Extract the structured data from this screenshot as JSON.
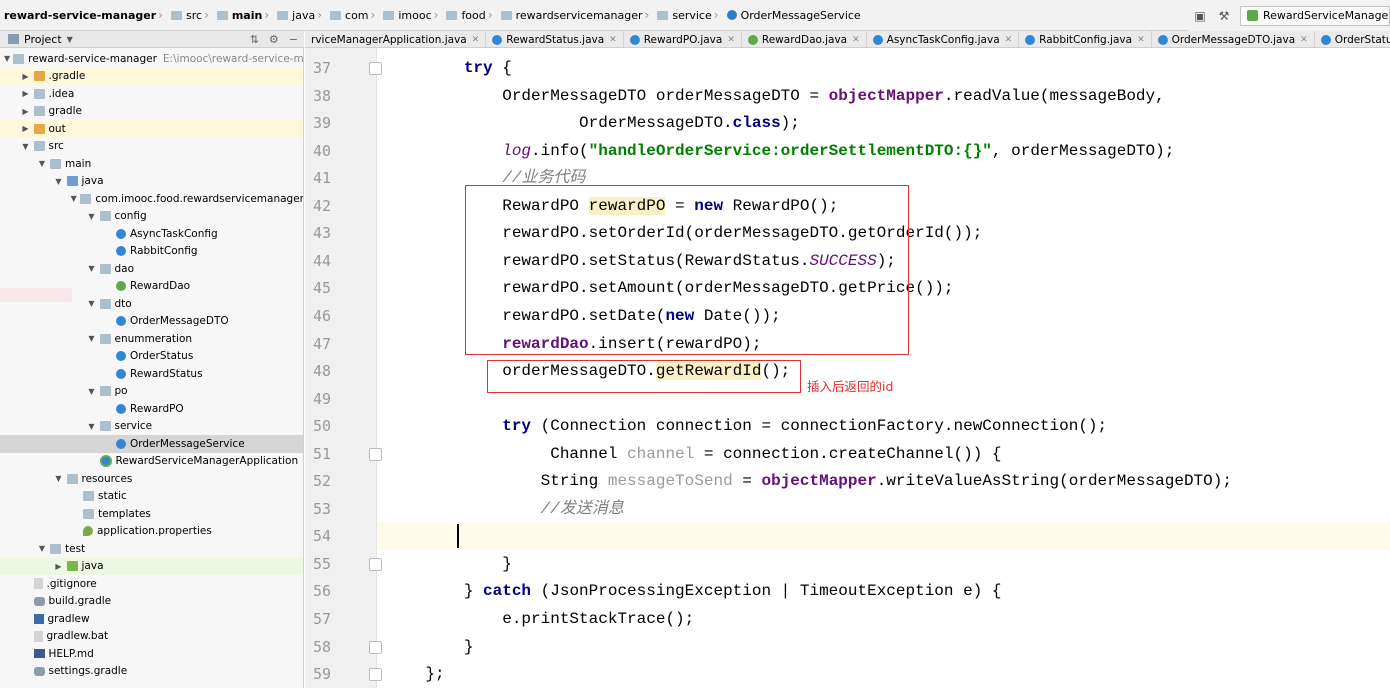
{
  "breadcrumb": [
    "reward-service-manager",
    "src",
    "main",
    "java",
    "com",
    "imooc",
    "food",
    "rewardservicemanager",
    "service",
    "OrderMessageService"
  ],
  "run_config": "RewardServiceManagerApplication",
  "project_panel": {
    "title": "Project",
    "root_label": "reward-service-manager",
    "root_path": "E:\\imooc\\reward-service-manager"
  },
  "tree": [
    {
      "label": ".gradle",
      "depth": 1,
      "arrow": "right",
      "icon": "folder-orange",
      "hl": "hl"
    },
    {
      "label": ".idea",
      "depth": 1,
      "arrow": "right",
      "icon": "folder"
    },
    {
      "label": "gradle",
      "depth": 1,
      "arrow": "right",
      "icon": "folder"
    },
    {
      "label": "out",
      "depth": 1,
      "arrow": "right",
      "icon": "folder-orange",
      "hl": "hl"
    },
    {
      "label": "src",
      "depth": 1,
      "arrow": "down",
      "icon": "folder"
    },
    {
      "label": "main",
      "depth": 2,
      "arrow": "down",
      "icon": "folder"
    },
    {
      "label": "java",
      "depth": 3,
      "arrow": "down",
      "icon": "folder-blue"
    },
    {
      "label": "com.imooc.food.rewardservicemanager",
      "depth": 4,
      "arrow": "down",
      "icon": "pkg"
    },
    {
      "label": "config",
      "depth": 5,
      "arrow": "down",
      "icon": "pkg"
    },
    {
      "label": "AsyncTaskConfig",
      "depth": 6,
      "arrow": "",
      "icon": "cls"
    },
    {
      "label": "RabbitConfig",
      "depth": 6,
      "arrow": "",
      "icon": "cls"
    },
    {
      "label": "dao",
      "depth": 5,
      "arrow": "down",
      "icon": "pkg"
    },
    {
      "label": "RewardDao",
      "depth": 6,
      "arrow": "",
      "icon": "intf"
    },
    {
      "label": "dto",
      "depth": 5,
      "arrow": "down",
      "icon": "pkg"
    },
    {
      "label": "OrderMessageDTO",
      "depth": 6,
      "arrow": "",
      "icon": "cls"
    },
    {
      "label": "enummeration",
      "depth": 5,
      "arrow": "down",
      "icon": "pkg"
    },
    {
      "label": "OrderStatus",
      "depth": 6,
      "arrow": "",
      "icon": "enumi"
    },
    {
      "label": "RewardStatus",
      "depth": 6,
      "arrow": "",
      "icon": "enumi"
    },
    {
      "label": "po",
      "depth": 5,
      "arrow": "down",
      "icon": "pkg"
    },
    {
      "label": "RewardPO",
      "depth": 6,
      "arrow": "",
      "icon": "cls"
    },
    {
      "label": "service",
      "depth": 5,
      "arrow": "down",
      "icon": "pkg"
    },
    {
      "label": "OrderMessageService",
      "depth": 6,
      "arrow": "",
      "icon": "cls",
      "hl": "sel"
    },
    {
      "label": "RewardServiceManagerApplication",
      "depth": 5,
      "arrow": "",
      "icon": "app"
    },
    {
      "label": "resources",
      "depth": 3,
      "arrow": "down",
      "icon": "folder"
    },
    {
      "label": "static",
      "depth": 4,
      "arrow": "",
      "icon": "folder"
    },
    {
      "label": "templates",
      "depth": 4,
      "arrow": "",
      "icon": "folder"
    },
    {
      "label": "application.properties",
      "depth": 4,
      "arrow": "",
      "icon": "props"
    },
    {
      "label": "test",
      "depth": 2,
      "arrow": "down",
      "icon": "folder"
    },
    {
      "label": "java",
      "depth": 3,
      "arrow": "right",
      "icon": "folder-green",
      "hl": "hlg"
    },
    {
      "label": ".gitignore",
      "depth": 1,
      "arrow": "",
      "icon": "file"
    },
    {
      "label": "build.gradle",
      "depth": 1,
      "arrow": "",
      "icon": "gradle"
    },
    {
      "label": "gradlew",
      "depth": 1,
      "arrow": "",
      "icon": "term"
    },
    {
      "label": "gradlew.bat",
      "depth": 1,
      "arrow": "",
      "icon": "file"
    },
    {
      "label": "HELP.md",
      "depth": 1,
      "arrow": "",
      "icon": "md"
    },
    {
      "label": "settings.gradle",
      "depth": 1,
      "arrow": "",
      "icon": "gradle"
    }
  ],
  "tabs": [
    {
      "label": "rviceManagerApplication.java",
      "icon": "app"
    },
    {
      "label": "RewardStatus.java",
      "icon": "c"
    },
    {
      "label": "RewardPO.java",
      "icon": "c"
    },
    {
      "label": "RewardDao.java",
      "icon": "g"
    },
    {
      "label": "AsyncTaskConfig.java",
      "icon": "c"
    },
    {
      "label": "RabbitConfig.java",
      "icon": "c"
    },
    {
      "label": "OrderMessageDTO.java",
      "icon": "c"
    },
    {
      "label": "OrderStatus.java",
      "icon": "c"
    }
  ],
  "code_lines": [
    {
      "no": "37",
      "fold": true,
      "html": "        <span class='kw'>try</span> {"
    },
    {
      "no": "38",
      "html": "            OrderMessageDTO orderMessageDTO = <span class='fld'>objectMapper</span>.readValue(messageBody,"
    },
    {
      "no": "39",
      "html": "                    OrderMessageDTO.<span class='kw'>class</span>);"
    },
    {
      "no": "40",
      "html": "            <span class='fldi'>log</span>.info(<span class='str'>\"handleOrderService:orderSettlementDTO:{}\"</span>, orderMessageDTO);"
    },
    {
      "no": "41",
      "html": "            <span class='cmt'>//业务代码</span>"
    },
    {
      "no": "42",
      "html": "            RewardPO <span class='sel-hl'>rewardPO</span> = <span class='kw'>new</span> RewardPO();"
    },
    {
      "no": "43",
      "html": "            rewardPO.setOrderId(orderMessageDTO.getOrderId());"
    },
    {
      "no": "44",
      "html": "            rewardPO.setStatus(RewardStatus.<span class='fldi'>SUCCESS</span>);"
    },
    {
      "no": "45",
      "html": "            rewardPO.setAmount(orderMessageDTO.getPrice());"
    },
    {
      "no": "46",
      "html": "            rewardPO.setDate(<span class='kw'>new</span> Date());"
    },
    {
      "no": "47",
      "html": "            <span class='fld'>rewardDao</span>.insert(rewardPO);"
    },
    {
      "no": "48",
      "html": "            orderMessageDTO.<span class='sel-hl'>getRewardId</span>();"
    },
    {
      "no": "49",
      "html": ""
    },
    {
      "no": "50",
      "html": "            <span class='kw'>try</span> (Connection connection = connectionFactory.newConnection();"
    },
    {
      "no": "51",
      "fold": true,
      "html": "                 Channel <span class='unused'>channel</span> = connection.createChannel()) {"
    },
    {
      "no": "52",
      "html": "                String <span class='unused'>messageToSend</span> = <span class='fld'>objectMapper</span>.writeValueAsString(orderMessageDTO);"
    },
    {
      "no": "53",
      "html": "                <span class='cmt'>//发送消息</span>"
    },
    {
      "no": "54",
      "html": ""
    },
    {
      "no": "55",
      "fold": true,
      "html": "            }"
    },
    {
      "no": "56",
      "html": "        } <span class='kw'>catch</span> (JsonProcessingException | TimeoutException e) {"
    },
    {
      "no": "57",
      "html": "            e.printStackTrace();"
    },
    {
      "no": "58",
      "fold": true,
      "html": "        }"
    },
    {
      "no": "59",
      "fold": true,
      "html": "    };"
    }
  ],
  "annotation": "插入后返回的id",
  "colors": {
    "annotation": "#e03030",
    "keyword": "#000080",
    "field": "#660e7a",
    "string": "#008000",
    "comment": "#808080"
  }
}
